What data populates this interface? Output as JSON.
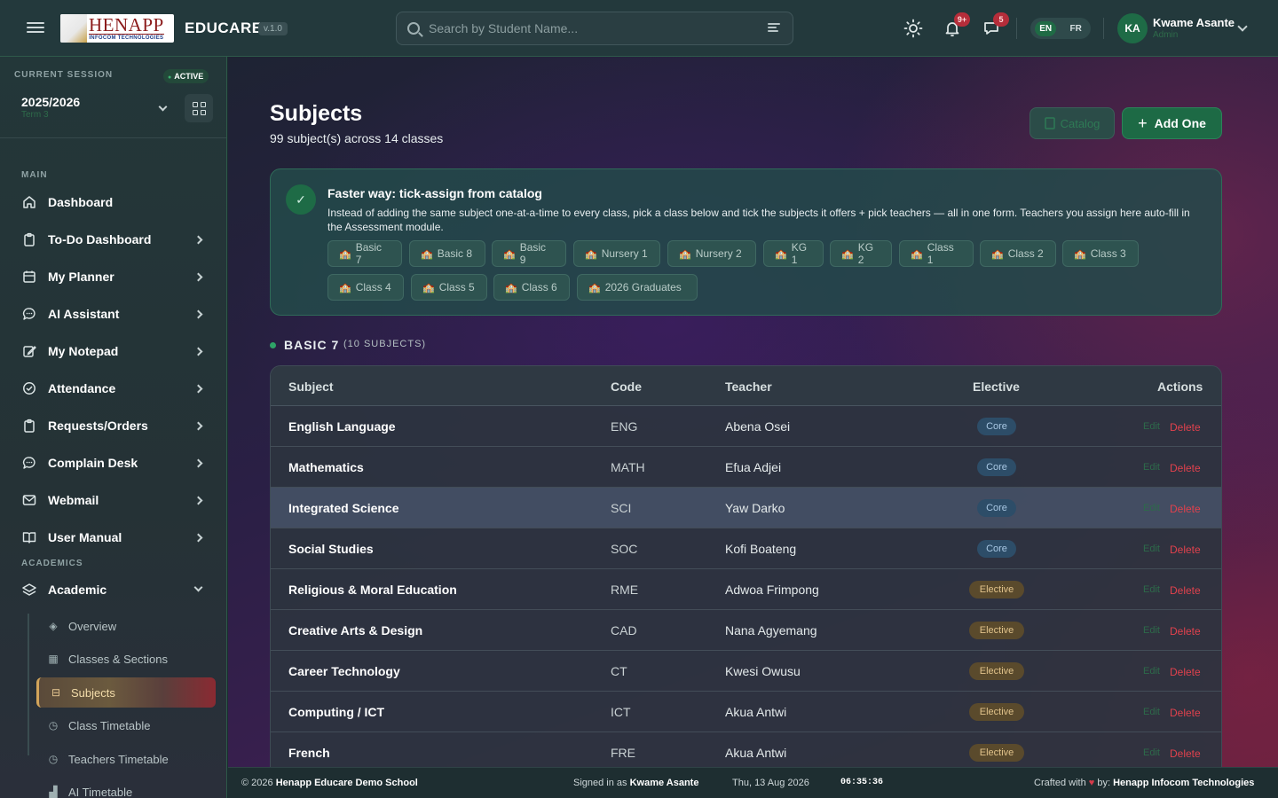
{
  "topbar": {
    "logo_main": "HENAPP",
    "logo_sub": "INFOCOM TECHNOLOGIES",
    "app_name": "EDUCARE",
    "version": "v.1.0",
    "search_placeholder": "Search by Student Name...",
    "notifications_count": "9+",
    "messages_count": "5",
    "lang_en": "EN",
    "lang_fr": "FR",
    "user_initials": "KA",
    "user_name": "Kwame Asante",
    "user_role": "Admin"
  },
  "session": {
    "label": "CURRENT SESSION",
    "status": "ACTIVE",
    "year": "2025/2026",
    "term": "Term 3"
  },
  "sidebar": {
    "main_label": "MAIN",
    "main_items": [
      {
        "label": "Dashboard",
        "icon": "home-icon"
      },
      {
        "label": "To-Do Dashboard",
        "icon": "clipboard-icon"
      },
      {
        "label": "My Planner",
        "icon": "calendar-icon"
      },
      {
        "label": "AI Assistant",
        "icon": "chat-icon"
      },
      {
        "label": "My Notepad",
        "icon": "edit-icon"
      },
      {
        "label": "Attendance",
        "icon": "check-circle-icon"
      },
      {
        "label": "Requests/Orders",
        "icon": "clipboard-icon"
      },
      {
        "label": "Complain Desk",
        "icon": "chat-icon"
      },
      {
        "label": "Webmail",
        "icon": "mail-icon"
      },
      {
        "label": "User Manual",
        "icon": "book-icon"
      }
    ],
    "academics_label": "ACADEMICS",
    "academic_label": "Academic",
    "academic_sub": [
      {
        "label": "Overview",
        "icon": "layers-icon"
      },
      {
        "label": "Classes & Sections",
        "icon": "building-icon"
      },
      {
        "label": "Subjects",
        "icon": "book-icon"
      },
      {
        "label": "Class Timetable",
        "icon": "clock-icon"
      },
      {
        "label": "Teachers Timetable",
        "icon": "clock-icon"
      },
      {
        "label": "AI Timetable",
        "icon": "chart-icon"
      }
    ]
  },
  "page": {
    "title": "Subjects",
    "subtitle": "99 subject(s) across 14 classes",
    "catalog_label": "Catalog",
    "add_label": "Add One"
  },
  "tip": {
    "title": "Faster way: tick-assign from catalog",
    "desc": "Instead of adding the same subject one-at-a-time to every class, pick a class below and tick the subjects it offers + pick teachers — all in one form. Teachers you assign here auto-fill in the Assessment module.",
    "chips": [
      "Basic 7",
      "Basic 8",
      "Basic 9",
      "Nursery 1",
      "Nursery 2",
      "KG 1",
      "KG 2",
      "Class 1",
      "Class 2",
      "Class 3",
      "Class 4",
      "Class 5",
      "Class 6",
      "2026 Graduates"
    ]
  },
  "group": {
    "name": "BASIC 7",
    "count": "(10 SUBJECTS)"
  },
  "table": {
    "headers": [
      "Subject",
      "Code",
      "Teacher",
      "Elective",
      "Actions"
    ],
    "edit_label": "Edit",
    "delete_label": "Delete",
    "rows": [
      {
        "subject": "English Language",
        "code": "ENG",
        "teacher": "Abena Osei",
        "type": "Core"
      },
      {
        "subject": "Mathematics",
        "code": "MATH",
        "teacher": "Efua Adjei",
        "type": "Core"
      },
      {
        "subject": "Integrated Science",
        "code": "SCI",
        "teacher": "Yaw Darko",
        "type": "Core"
      },
      {
        "subject": "Social Studies",
        "code": "SOC",
        "teacher": "Kofi Boateng",
        "type": "Core"
      },
      {
        "subject": "Religious & Moral Education",
        "code": "RME",
        "teacher": "Adwoa Frimpong",
        "type": "Elective"
      },
      {
        "subject": "Creative Arts & Design",
        "code": "CAD",
        "teacher": "Nana Agyemang",
        "type": "Elective"
      },
      {
        "subject": "Career Technology",
        "code": "CT",
        "teacher": "Kwesi Owusu",
        "type": "Elective"
      },
      {
        "subject": "Computing / ICT",
        "code": "ICT",
        "teacher": "Akua Antwi",
        "type": "Elective"
      },
      {
        "subject": "French",
        "code": "FRE",
        "teacher": "Akua Antwi",
        "type": "Elective"
      }
    ]
  },
  "footer": {
    "copyright": "© 2026",
    "school": "Henapp Educare Demo School",
    "signed_prefix": "Signed in as",
    "signed_user": "Kwame Asante",
    "date": "Thu, 13 Aug 2026",
    "time": "06:35:36",
    "crafted_prefix": "Crafted with",
    "crafted_by": "by:",
    "company": "Henapp Infocom Technologies"
  }
}
